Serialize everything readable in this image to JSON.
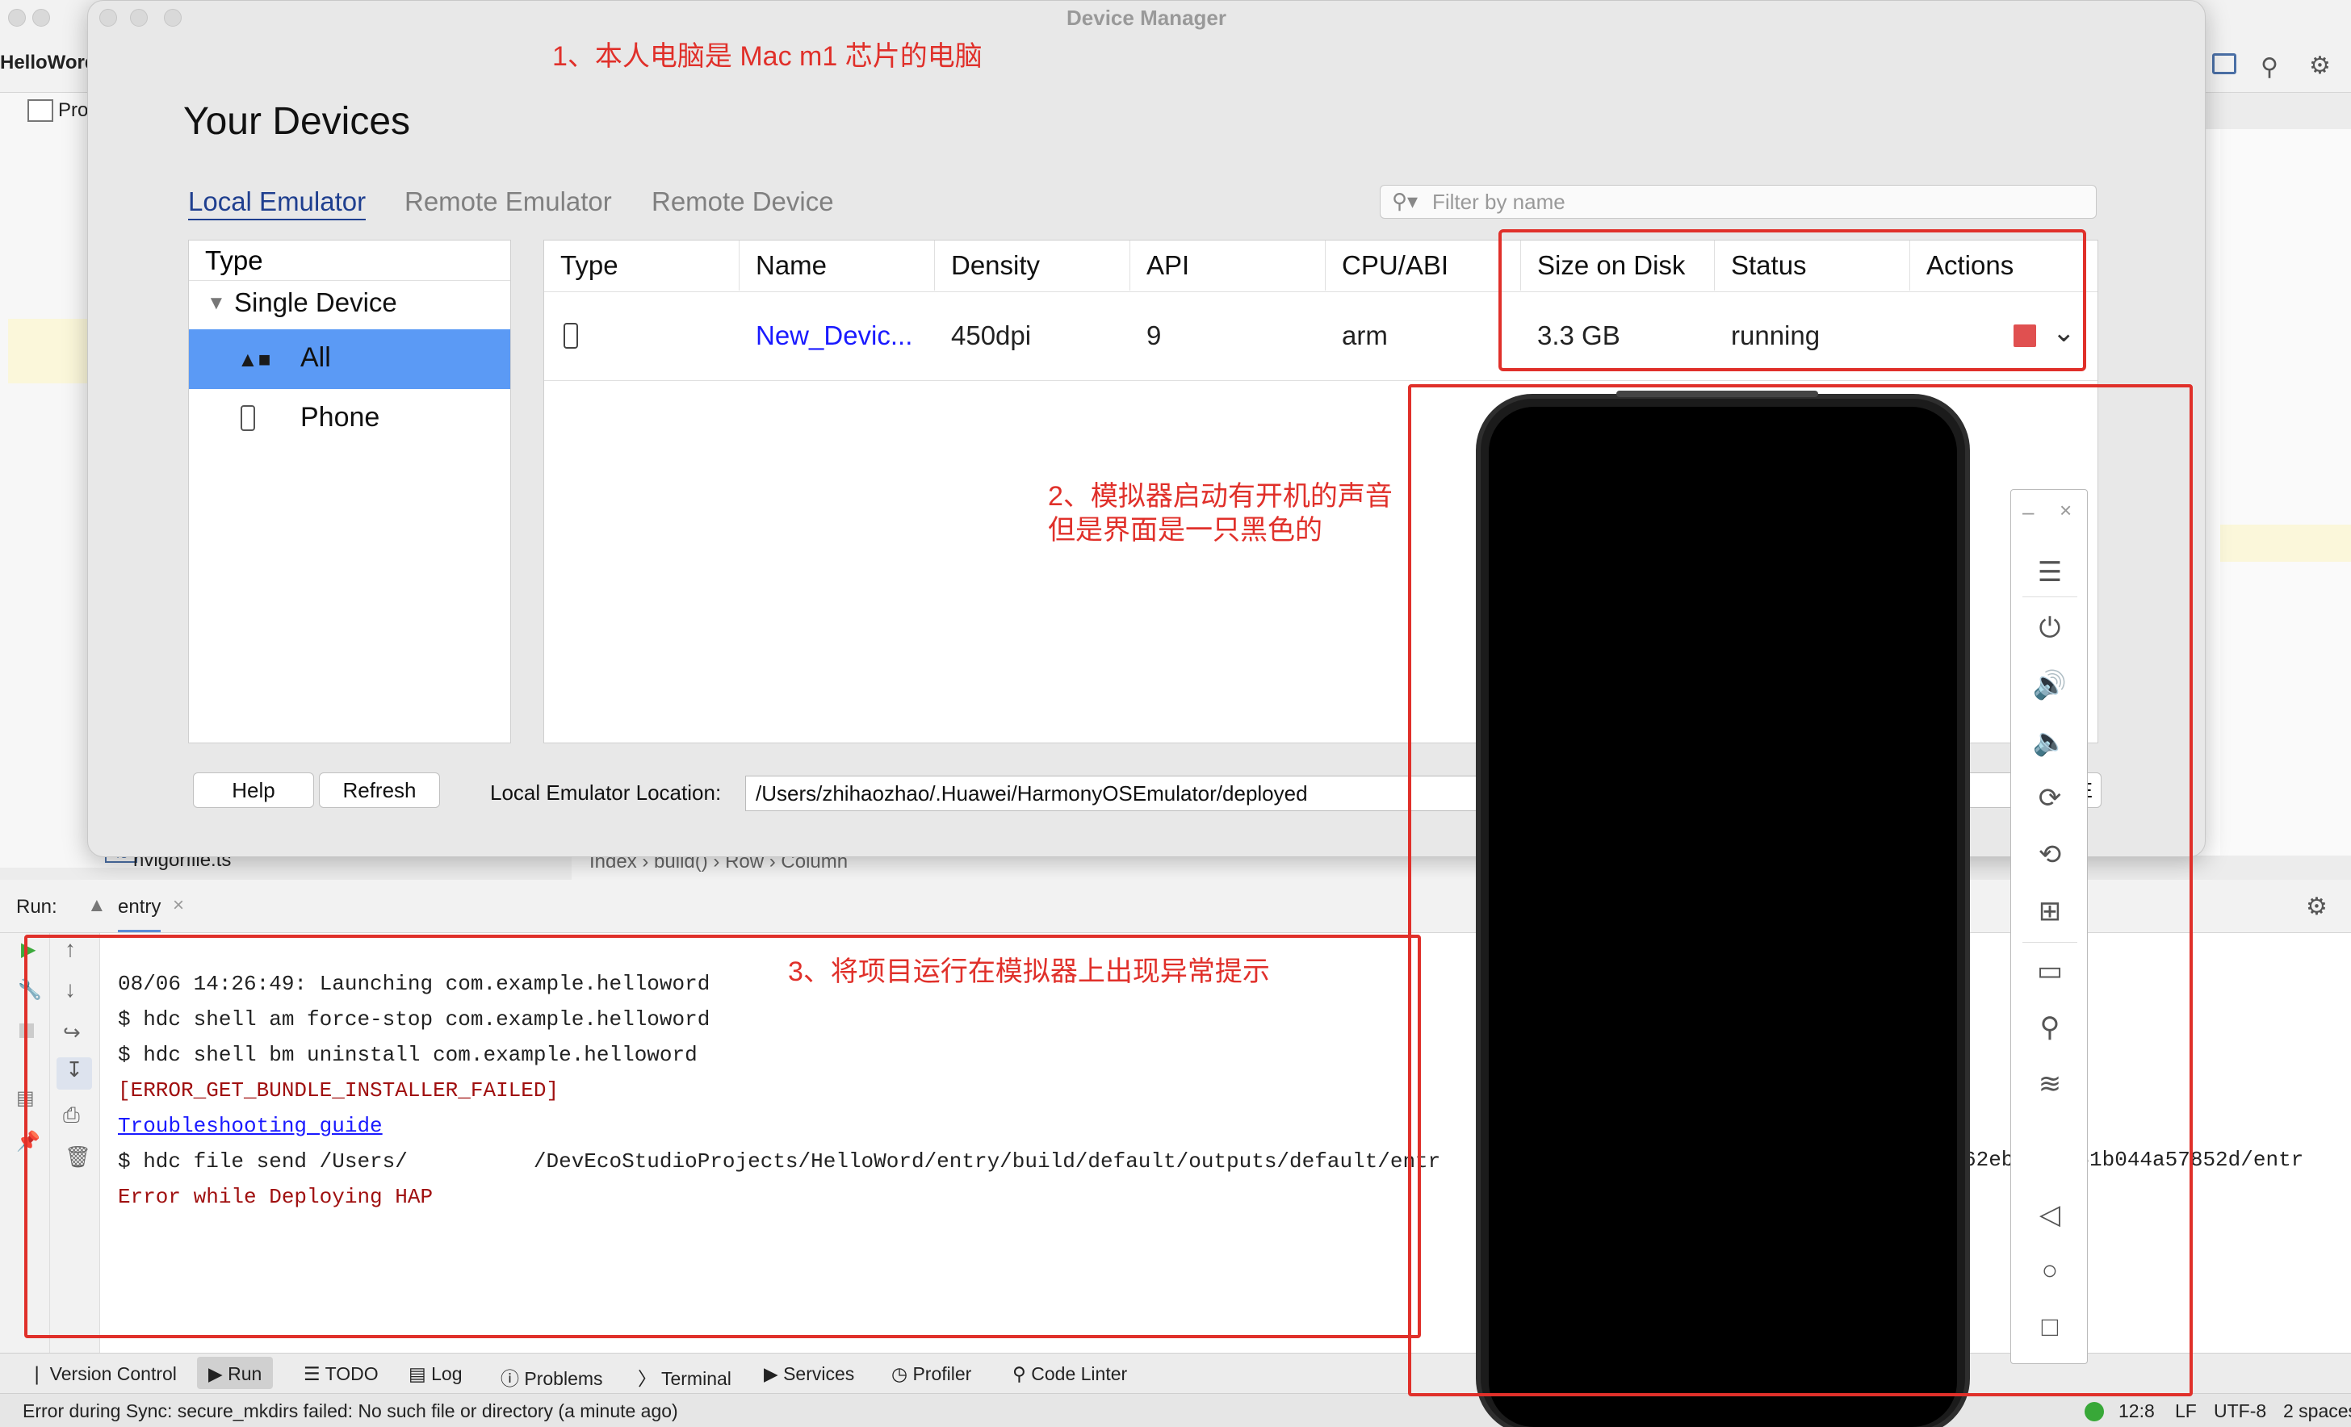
{
  "ide": {
    "project_name": "HelloWord",
    "project_tab": "Pro",
    "file_name": "hvigorfile.ts",
    "breadcrumbs": [
      "Index",
      "build()",
      "Row",
      "Column"
    ]
  },
  "dialog": {
    "title": "Device Manager",
    "heading": "Your Devices",
    "tabs": [
      "Local Emulator",
      "Remote Emulator",
      "Remote Device"
    ],
    "filter_placeholder": "Filter by name",
    "type_panel": {
      "header": "Type",
      "group": "Single Device",
      "items": [
        "All",
        "Phone"
      ],
      "selected": "All"
    },
    "table": {
      "columns": [
        "Type",
        "Name",
        "Density",
        "API",
        "CPU/ABI",
        "Size on Disk",
        "Status",
        "Actions"
      ],
      "rows": [
        {
          "name": "New_Devic...",
          "density": "450dpi",
          "api": "9",
          "cpu": "arm",
          "size": "3.3 GB",
          "status": "running"
        }
      ]
    },
    "help_label": "Help",
    "refresh_label": "Refresh",
    "location_label": "Local Emulator Location:",
    "location_value": "/Users/zhihaozhao/.Huawei/HarmonyOSEmulator/deployed",
    "new_emulator_partial": "w E"
  },
  "annotations": {
    "note1": "1、本人电脑是 Mac m1 芯片的电脑",
    "note2_line1": "2、模拟器启动有开机的声音",
    "note2_line2": "但是界面是一只黑色的",
    "note3": "3、将项目运行在模拟器上出现异常提示"
  },
  "run": {
    "label": "Run:",
    "config": "entry",
    "console": [
      {
        "text": "08/06 14:26:49: Launching com.example.helloword",
        "kind": "normal"
      },
      {
        "text": "$ hdc shell am force-stop com.example.helloword",
        "kind": "normal"
      },
      {
        "text": "$ hdc shell bm uninstall com.example.helloword",
        "kind": "normal"
      },
      {
        "text": "[ERROR_GET_BUNDLE_INSTALLER_FAILED]",
        "kind": "error"
      },
      {
        "text": "Troubleshooting guide",
        "kind": "link"
      },
      {
        "text": "$ hdc file send /Users/          /DevEcoStudioProjects/HelloWord/entry/build/default/outputs/default/entr",
        "kind": "normal"
      },
      {
        "text": "Error while Deploying HAP",
        "kind": "error"
      }
    ],
    "console_tail": "62eb   1661b044a57852d/entr"
  },
  "tool_windows": [
    "Version Control",
    "Run",
    "TODO",
    "Log",
    "Problems",
    "Terminal",
    "Services",
    "Profiler",
    "Code Linter"
  ],
  "status": {
    "message": "Error during Sync: secure_mkdirs failed: No such file or directory (a minute ago)",
    "position": "12:8",
    "line_sep": "LF",
    "encoding": "UTF-8",
    "indent": "2 spaces"
  },
  "colors": {
    "accent_red": "#e0302a",
    "selection": "#5b9af5",
    "link": "#1a1aff",
    "error": "#a01010"
  }
}
